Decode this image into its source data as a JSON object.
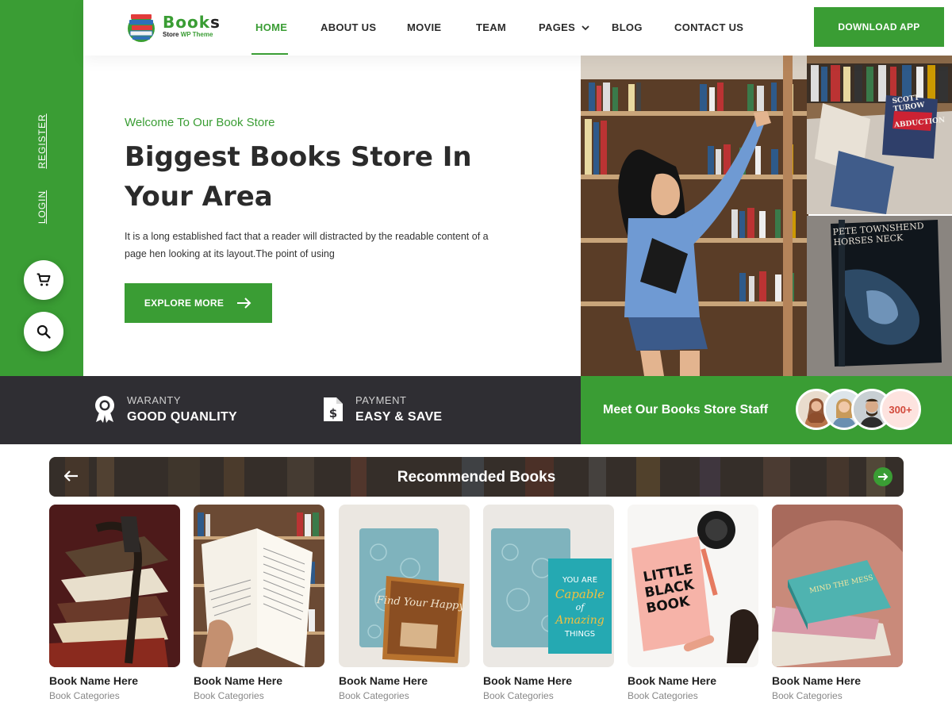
{
  "brand": {
    "name_main": "Book",
    "name_last": "s",
    "tagline_a": "Store",
    "tagline_b": "WP Theme"
  },
  "nav": {
    "items": [
      "HOME",
      "ABOUT US",
      "MOVIE",
      "TEAM",
      "PAGES",
      "BLOG",
      "CONTACT US"
    ],
    "active": "HOME",
    "pages_has_dropdown": true,
    "download_label": "DOWNLOAD APP"
  },
  "sidebar": {
    "register": "REGISTER",
    "login": "LOGIN",
    "icons": [
      "cart-icon",
      "search-icon"
    ]
  },
  "hero": {
    "welcome": "Welcome To Our Book Store",
    "headline_line1": "Biggest Books Store In",
    "headline_line2": "Your Area",
    "lead_line1": "It is a long established fact that a reader will distracted by the readable content of a",
    "lead_line2": "page hen looking at its layout.The point of using",
    "cta": "EXPLORE MORE",
    "photo_texts": {
      "book_cover": "PETE TOWNSHEND HORSES NECK",
      "spine_1": "SCOTT TUROW",
      "spine_2": "ABDUCTION"
    }
  },
  "features": [
    {
      "small": "WARANTY",
      "big": "GOOD QUANLITY",
      "icon": "award-badge-icon"
    },
    {
      "small": "PAYMENT",
      "big": "EASY & SAVE",
      "icon": "dollar-document-icon"
    }
  ],
  "staff": {
    "label": "Meet Our Books Store Staff",
    "count": "300+"
  },
  "recommended": {
    "title": "Recommended Books",
    "books": [
      {
        "name": "Book Name Here",
        "category": "Book Categories"
      },
      {
        "name": "Book Name Here",
        "category": "Book Categories"
      },
      {
        "name": "Book Name Here",
        "category": "Book Categories"
      },
      {
        "name": "Book Name Here",
        "category": "Book Categories"
      },
      {
        "name": "Book Name Here",
        "category": "Book Categories"
      },
      {
        "name": "Book Name Here",
        "category": "Book Categories"
      }
    ],
    "cover_texts": {
      "book3": "Find Your Happy",
      "book4_a": "YOU ARE",
      "book4_b": "Capable",
      "book4_c": "of",
      "book4_d": "Amazing",
      "book4_e": "THINGS",
      "book5_a": "LITTLE",
      "book5_b": "BLACK",
      "book5_c": "BOOK",
      "book6": "MIND THE MESS"
    }
  },
  "colors": {
    "accent": "#3a9d34",
    "dark": "#2f2e33",
    "text": "#2b2b2b",
    "badge_bg": "#fde3df"
  }
}
